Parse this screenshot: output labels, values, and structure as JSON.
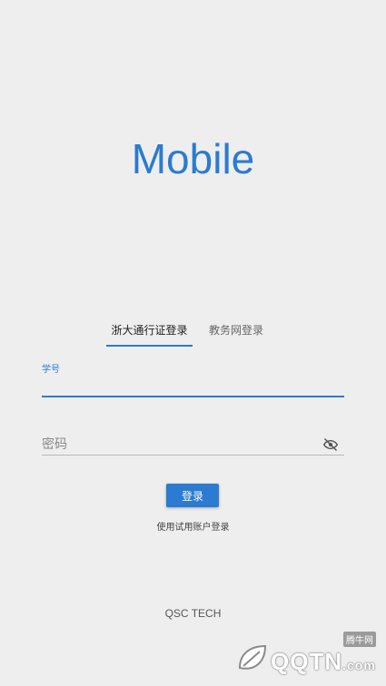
{
  "app": {
    "title": "Mobile"
  },
  "tabs": [
    {
      "label": "浙大通行证登录",
      "active": true
    },
    {
      "label": "教务网登录",
      "active": false
    }
  ],
  "form": {
    "student_id": {
      "label": "学号",
      "value": ""
    },
    "password": {
      "placeholder": "密码",
      "value": ""
    },
    "login_label": "登录",
    "trial_link": "使用试用账户登录"
  },
  "footer": {
    "brand": "QSC TECH"
  },
  "watermark": {
    "text": "QQTN",
    "suffix": ".com",
    "small": "腾牛网"
  },
  "colors": {
    "accent": "#2b7bd0",
    "background": "#eeeeee"
  },
  "icons": {
    "password_toggle": "eye-off-icon"
  }
}
